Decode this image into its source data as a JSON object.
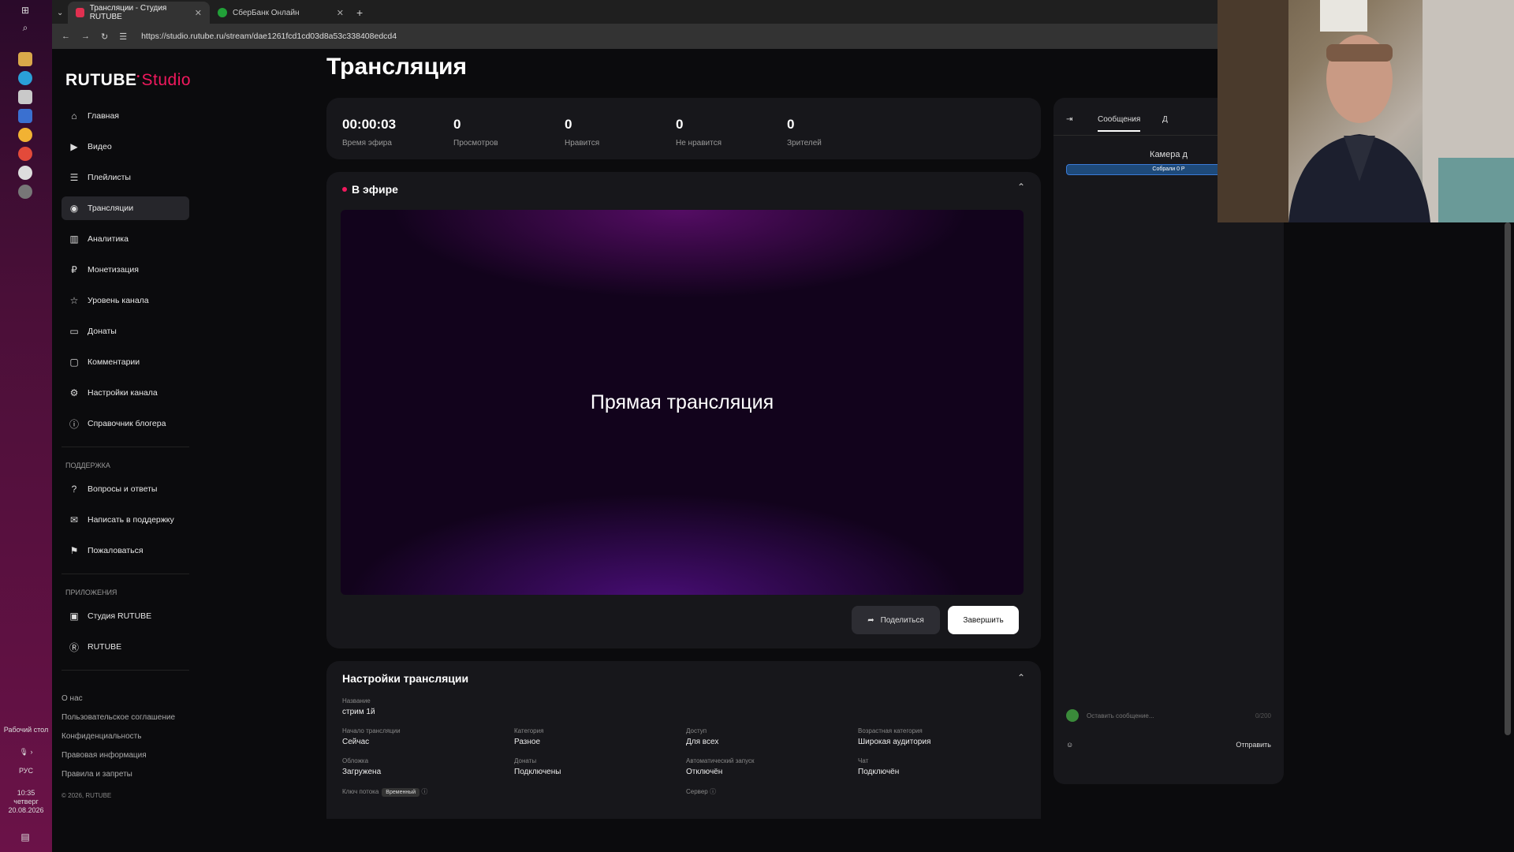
{
  "taskbar": {
    "desktop_label": "Рабочий стол",
    "lang": "РУС",
    "time": "10:35",
    "weekday": "четверг",
    "date": "20.08.2026"
  },
  "browser": {
    "tabs": [
      {
        "title": "Трансляции - Студия RUTUBE"
      },
      {
        "title": "СберБанк Онлайн"
      }
    ],
    "url": "https://studio.rutube.ru/stream/dae1261fcd1cd03d8a53c338408edcd4"
  },
  "brand": {
    "name": "RUTUBE",
    "suffix": "Studio"
  },
  "nav": {
    "items": [
      {
        "label": "Главная",
        "icon": "home-icon"
      },
      {
        "label": "Видео",
        "icon": "video-icon"
      },
      {
        "label": "Плейлисты",
        "icon": "playlist-icon"
      },
      {
        "label": "Трансляции",
        "icon": "broadcast-icon"
      },
      {
        "label": "Аналитика",
        "icon": "analytics-icon"
      },
      {
        "label": "Монетизация",
        "icon": "monetization-icon"
      },
      {
        "label": "Уровень канала",
        "icon": "star-icon"
      },
      {
        "label": "Донаты",
        "icon": "wallet-icon"
      },
      {
        "label": "Комментарии",
        "icon": "comment-icon"
      },
      {
        "label": "Настройки канала",
        "icon": "gear-icon"
      },
      {
        "label": "Справочник блогера",
        "icon": "info-icon"
      }
    ],
    "support_heading": "ПОДДЕРЖКА",
    "support": [
      {
        "label": "Вопросы и ответы",
        "icon": "question-icon"
      },
      {
        "label": "Написать в поддержку",
        "icon": "mail-icon"
      },
      {
        "label": "Пожаловаться",
        "icon": "flag-icon"
      }
    ],
    "apps_heading": "ПРИЛОЖЕНИЯ",
    "apps": [
      {
        "label": "Студия RUTUBE",
        "icon": "studio-icon"
      },
      {
        "label": "RUTUBE",
        "icon": "rutube-icon"
      }
    ],
    "footer": [
      "О нас",
      "Пользовательское соглашение",
      "Конфиденциальность",
      "Правовая информация",
      "Правила и запреты"
    ],
    "copyright": "© 2026, RUTUBE"
  },
  "page": {
    "title": "Трансляция"
  },
  "stats": [
    {
      "value": "00:00:03",
      "label": "Время эфира"
    },
    {
      "value": "0",
      "label": "Просмотров"
    },
    {
      "value": "0",
      "label": "Нравится"
    },
    {
      "value": "0",
      "label": "Не нравится"
    },
    {
      "value": "0",
      "label": "Зрителей"
    }
  ],
  "live": {
    "status": "В эфире",
    "player_text": "Прямая трансляция",
    "share_label": "Поделиться",
    "end_label": "Завершить"
  },
  "settings": {
    "title": "Настройки трансляции",
    "name_label": "Название",
    "name_value": "стрим 1й",
    "start_label": "Начало трансляции",
    "start_value": "Сейчас",
    "category_label": "Категория",
    "category_value": "Разное",
    "access_label": "Доступ",
    "access_value": "Для всех",
    "age_label": "Возрастная категория",
    "age_value": "Широкая аудитория",
    "cover_label": "Обложка",
    "cover_value": "Загружена",
    "donations_label": "Донаты",
    "donations_value": "Подключены",
    "autostart_label": "Автоматический запуск",
    "autostart_value": "Отключён",
    "chat_label": "Чат",
    "chat_value": "Подключён",
    "key_label": "Ключ потока",
    "key_badge": "Временный",
    "server_label": "Сервер"
  },
  "chat": {
    "tab_messages": "Сообщения",
    "tab_other": "Д",
    "poll_title": "Камера д",
    "poll_bar": "Собрали 0 Р",
    "input_placeholder": "Оставить сообщение...",
    "counter": "0/200",
    "send_label": "Отправить"
  },
  "colors": {
    "accent": "#f1195e",
    "background": "#0b0b0d",
    "card": "#17171b"
  }
}
